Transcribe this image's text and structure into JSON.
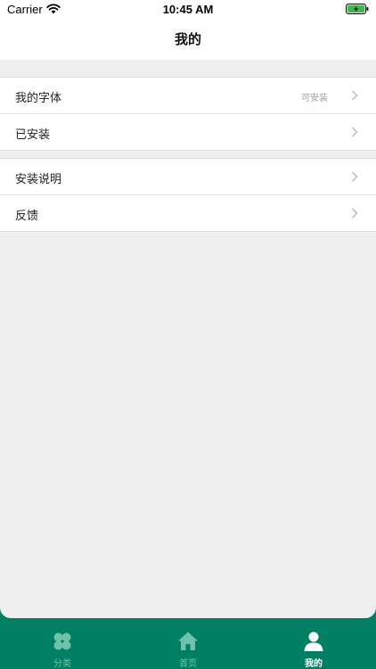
{
  "status_bar": {
    "carrier": "Carrier",
    "time": "10:45 AM"
  },
  "header": {
    "title": "我的"
  },
  "groups": [
    {
      "rows": [
        {
          "label": "我的字体",
          "value": "可安装"
        },
        {
          "label": "已安装",
          "value": ""
        }
      ]
    },
    {
      "rows": [
        {
          "label": "安装说明",
          "value": ""
        },
        {
          "label": "反馈",
          "value": ""
        }
      ]
    }
  ],
  "tabbar": {
    "tabs": [
      {
        "label": "分类",
        "icon": "clover-icon",
        "active": false
      },
      {
        "label": "首页",
        "icon": "home-icon",
        "active": false
      },
      {
        "label": "我的",
        "icon": "person-icon",
        "active": true
      }
    ]
  },
  "colors": {
    "accent": "#008062",
    "inactive_tab": "#6fc2a9",
    "background": "#efefef"
  }
}
